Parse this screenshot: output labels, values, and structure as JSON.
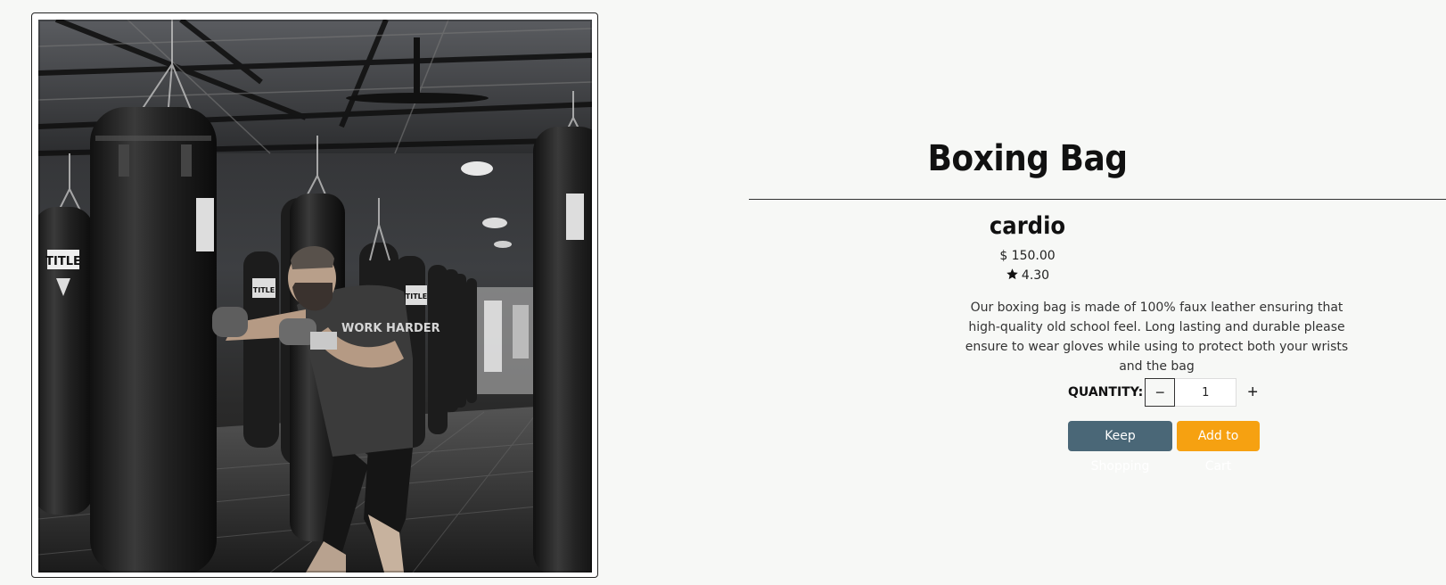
{
  "product": {
    "title": "Boxing Bag",
    "category": "cardio",
    "price": "$ 150.00",
    "rating": "4.30",
    "description": "Our boxing bag is made of 100% faux leather ensuring that high-quality old school feel. Long lasting and durable please ensure to wear gloves while using to protect both your wrists and the bag",
    "image_alt": "Man punching a boxing bag in a gym",
    "bag_brand": "TITLE",
    "shirt_text": "WORK HARDER"
  },
  "quantity": {
    "label": "QUANTITY:",
    "value": "1",
    "minus": "−",
    "plus": "+"
  },
  "actions": {
    "keep_shopping": "Keep Shopping",
    "add_to_cart": "Add to Cart"
  },
  "colors": {
    "background": "#f7f8f6",
    "keep_shopping": "#4a6777",
    "add_to_cart": "#f6a111"
  },
  "icons": {
    "rating": "star-icon",
    "decrement": "minus-icon",
    "increment": "plus-icon"
  }
}
